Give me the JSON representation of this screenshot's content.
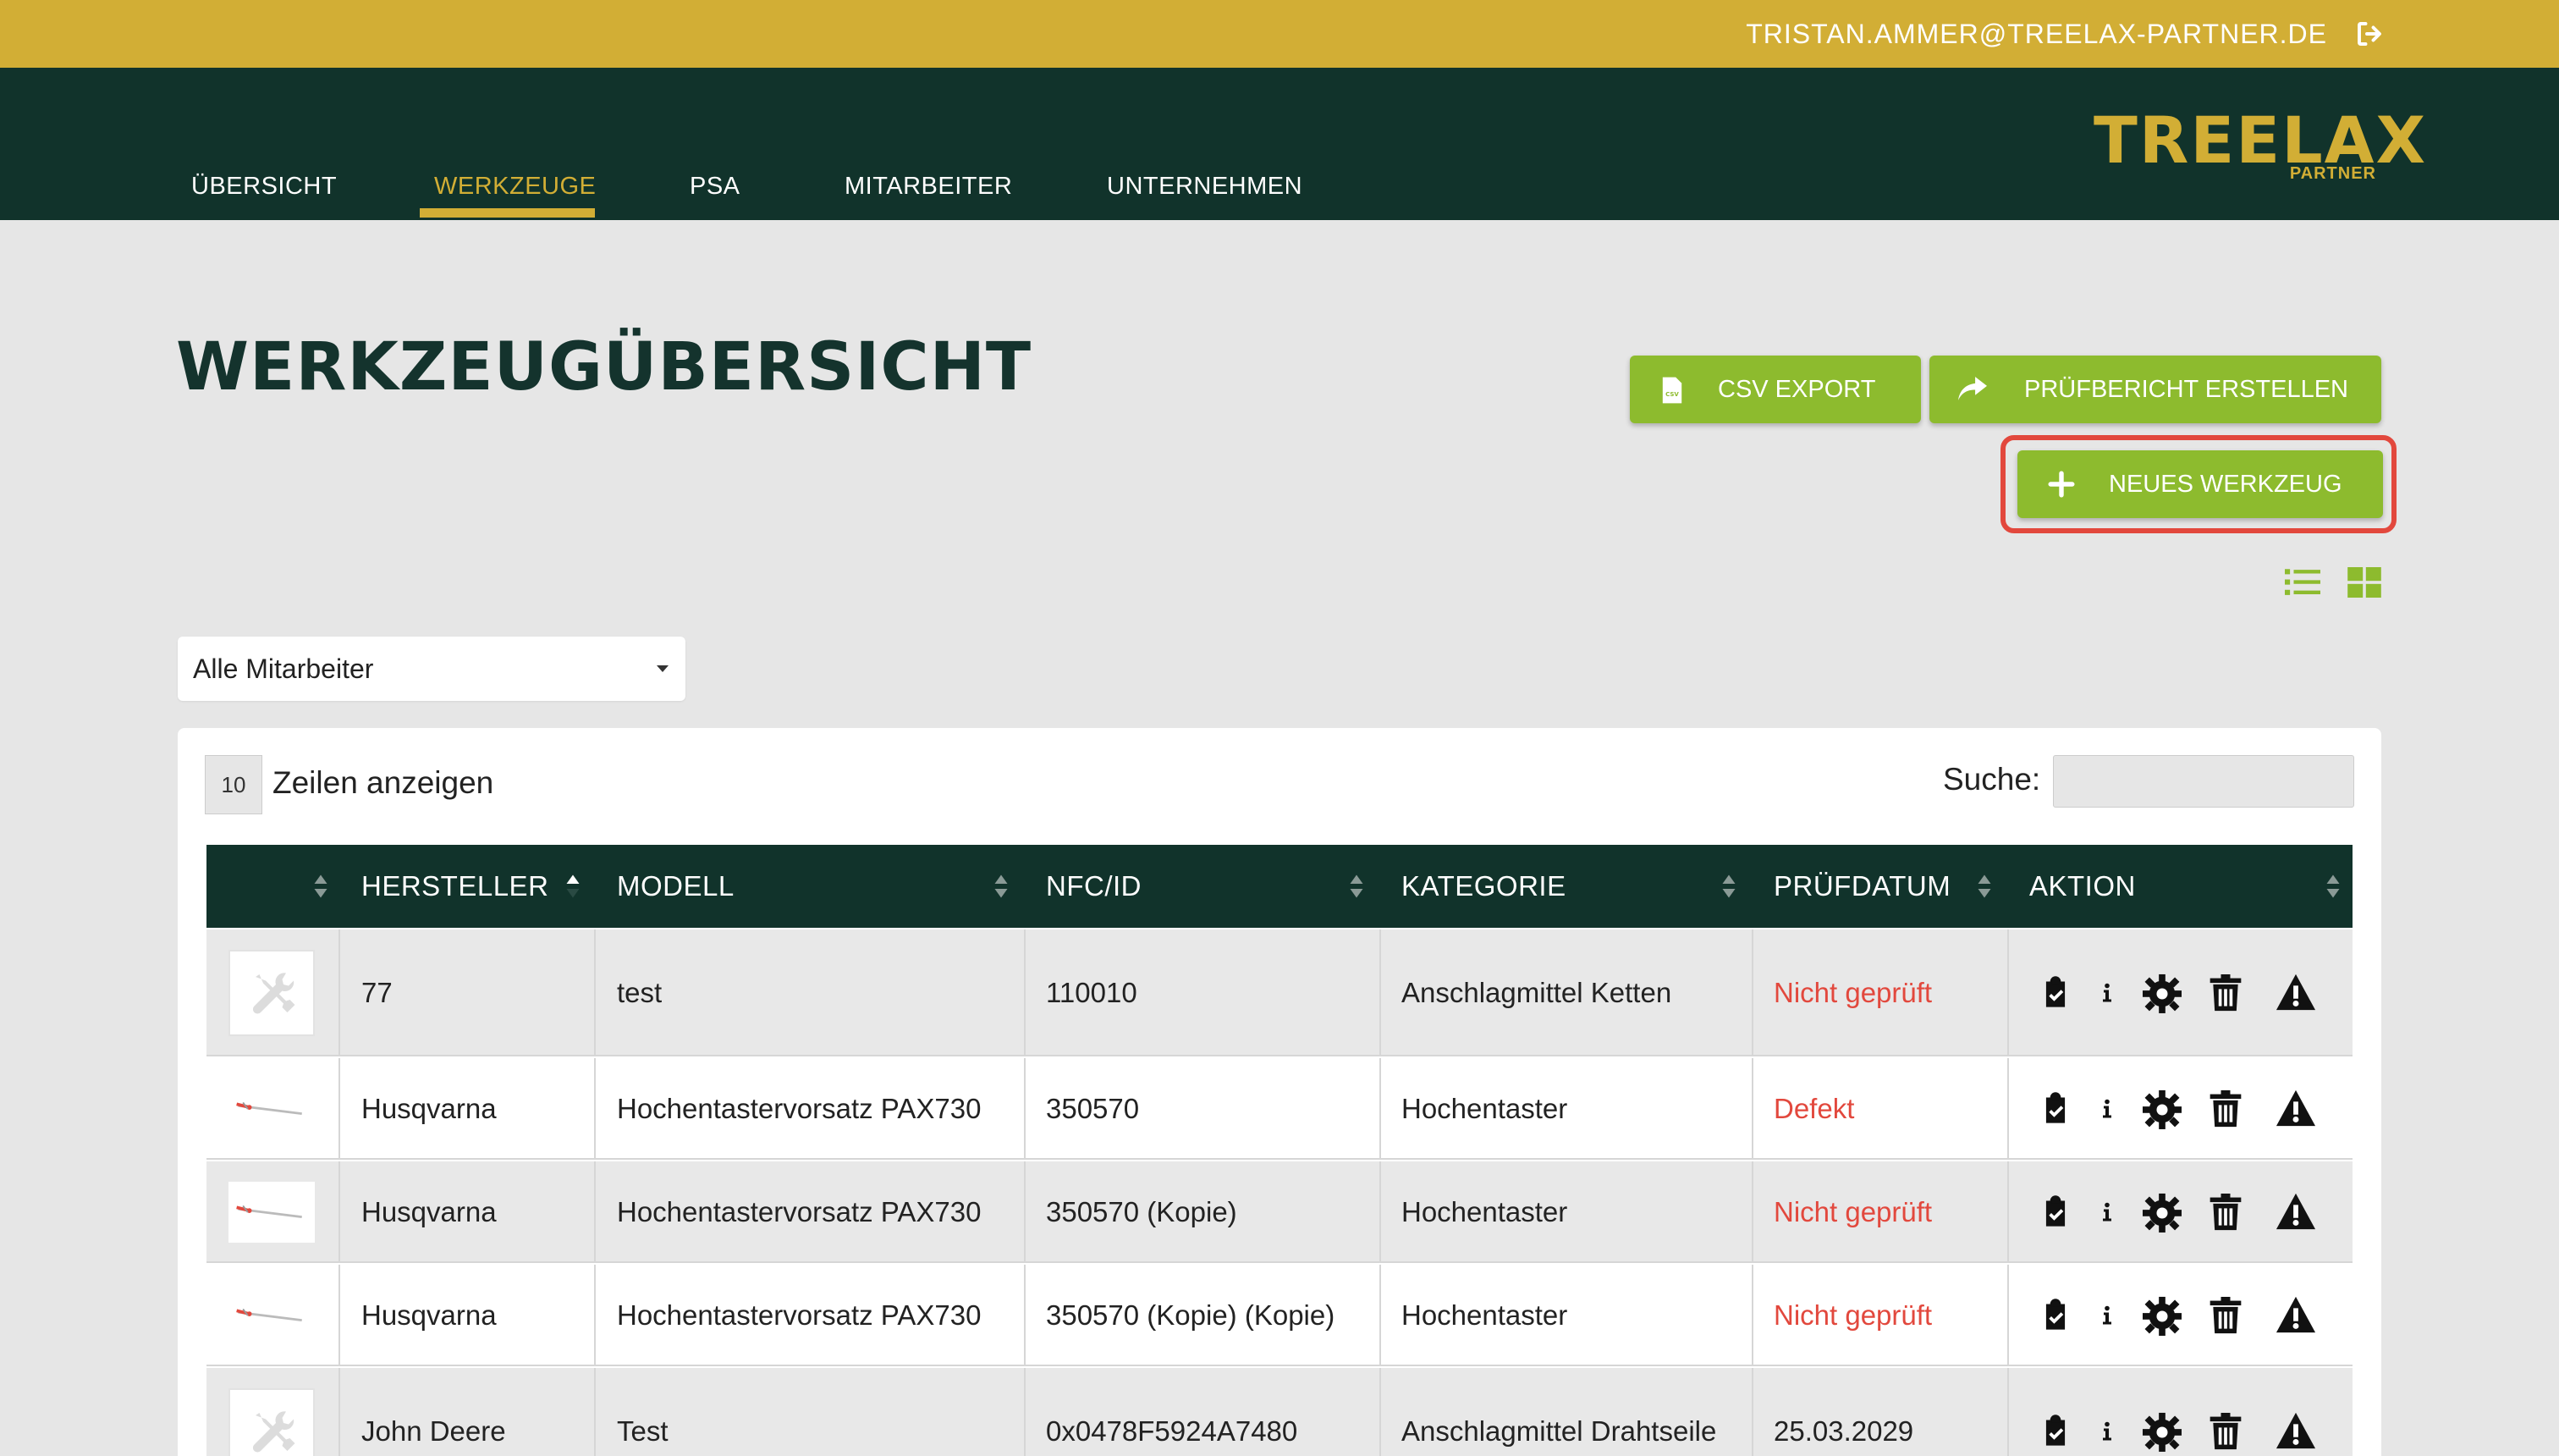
{
  "topbar": {
    "user_email": "TRISTAN.AMMER@TREELAX-PARTNER.DE",
    "logout_icon": "sign-out-icon"
  },
  "nav": {
    "items": [
      {
        "label": "ÜBERSICHT",
        "active": false
      },
      {
        "label": "WERKZEUGE",
        "active": true
      },
      {
        "label": "PSA",
        "active": false
      },
      {
        "label": "MITARBEITER",
        "active": false
      },
      {
        "label": "UNTERNEHMEN",
        "active": false
      }
    ]
  },
  "logo": {
    "main": "TREELAX",
    "sub": "PARTNER"
  },
  "page": {
    "title": "WERKZEUGÜBERSICHT"
  },
  "toolbar": {
    "csv_label": "CSV EXPORT",
    "report_label": "PRÜFBERICHT ERSTELLEN",
    "new_label": "NEUES WERKZEUG",
    "csv_icon": "csv-file-icon",
    "report_icon": "share-arrow-icon",
    "new_icon": "plus-icon",
    "view_icons": [
      "list-view-icon",
      "grid-view-icon"
    ]
  },
  "filter": {
    "selected": "Alle Mitarbeiter"
  },
  "table_controls": {
    "rows_value": "10",
    "rows_label": "Zeilen anzeigen",
    "search_label": "Suche:"
  },
  "table": {
    "columns": [
      "",
      "HERSTELLER",
      "MODELL",
      "NFC/ID",
      "KATEGORIE",
      "PRÜFDATUM",
      "AKTION"
    ],
    "rows": [
      {
        "image": "tool-placeholder-icon",
        "hersteller": "77",
        "modell": "test",
        "nfc": "110010",
        "kategorie": "Anschlagmittel Ketten",
        "pruefdatum": "Nicht geprüft",
        "status": "warn"
      },
      {
        "image": "pole-pruner-image",
        "hersteller": "Husqvarna",
        "modell": "Hochentastervorsatz PAX730",
        "nfc": "350570",
        "kategorie": "Hochentaster",
        "pruefdatum": "Defekt",
        "status": "warn"
      },
      {
        "image": "pole-pruner-image",
        "hersteller": "Husqvarna",
        "modell": "Hochentastervorsatz PAX730",
        "nfc": "350570 (Kopie)",
        "kategorie": "Hochentaster",
        "pruefdatum": "Nicht geprüft",
        "status": "warn"
      },
      {
        "image": "pole-pruner-image",
        "hersteller": "Husqvarna",
        "modell": "Hochentastervorsatz PAX730",
        "nfc": "350570 (Kopie) (Kopie)",
        "kategorie": "Hochentaster",
        "pruefdatum": "Nicht geprüft",
        "status": "warn"
      },
      {
        "image": "tool-placeholder-icon",
        "hersteller": "John Deere",
        "modell": "Test",
        "nfc": "0x0478F5924A7480",
        "kategorie": "Anschlagmittel Drahtseile",
        "pruefdatum": "25.03.2029",
        "status": "ok"
      }
    ],
    "actions": [
      "clipboard-check-icon",
      "info-icon",
      "gear-icon",
      "trash-icon",
      "warning-icon"
    ]
  },
  "colors": {
    "gold": "#d2ae35",
    "dark_green": "#11332b",
    "lime": "#8dbb2e",
    "alert_red": "#e2483d"
  }
}
